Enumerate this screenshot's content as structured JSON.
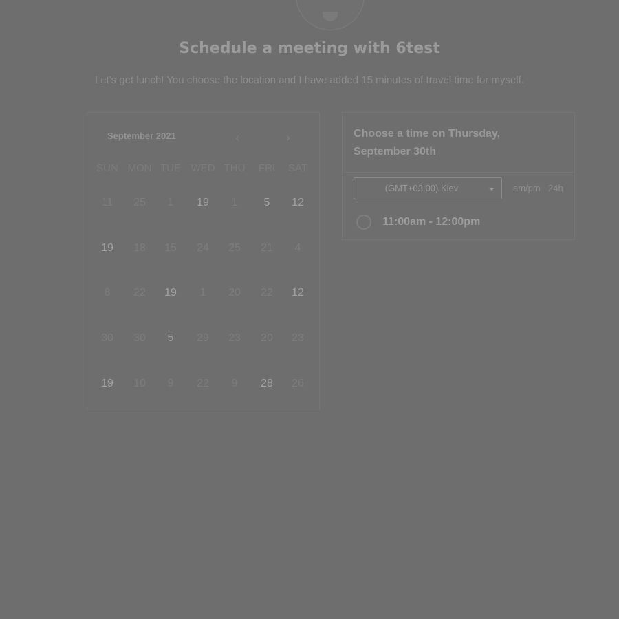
{
  "page": {
    "title": "Schedule a meeting with 6test",
    "description": "Let's get lunch! You choose the location and I have added 15 minutes of travel time for myself."
  },
  "calendar": {
    "month_label": "September 2021",
    "prev_icon": "chevron-left-icon",
    "next_icon": "chevron-right-icon",
    "weekdays": [
      "SUN",
      "MON",
      "TUE",
      "WED",
      "THU",
      "FRI",
      "SAT"
    ],
    "weeks": [
      [
        "11",
        "25",
        "1",
        "19",
        "1",
        "5",
        "12"
      ],
      [
        "19",
        "18",
        "15",
        "24",
        "25",
        "21",
        "4"
      ],
      [
        "8",
        "22",
        "19",
        "1",
        "20",
        "22",
        "12"
      ],
      [
        "30",
        "30",
        "5",
        "29",
        "23",
        "20",
        "23"
      ],
      [
        "19",
        "10",
        "9",
        "22",
        "9",
        "28",
        "26"
      ]
    ],
    "available": [
      [
        false,
        false,
        false,
        true,
        false,
        true,
        true
      ],
      [
        true,
        false,
        false,
        false,
        false,
        false,
        false
      ],
      [
        false,
        false,
        true,
        false,
        false,
        false,
        true
      ],
      [
        false,
        false,
        true,
        false,
        false,
        false,
        false
      ],
      [
        true,
        false,
        false,
        false,
        false,
        true,
        false
      ]
    ]
  },
  "time_panel": {
    "heading": "Choose a time on Thursday, September 30th",
    "timezone": "(GMT+03:00) Kiev",
    "format_ampm": "am/pm",
    "format_24h": "24h",
    "slot": "11:00am - 12:00pm"
  }
}
